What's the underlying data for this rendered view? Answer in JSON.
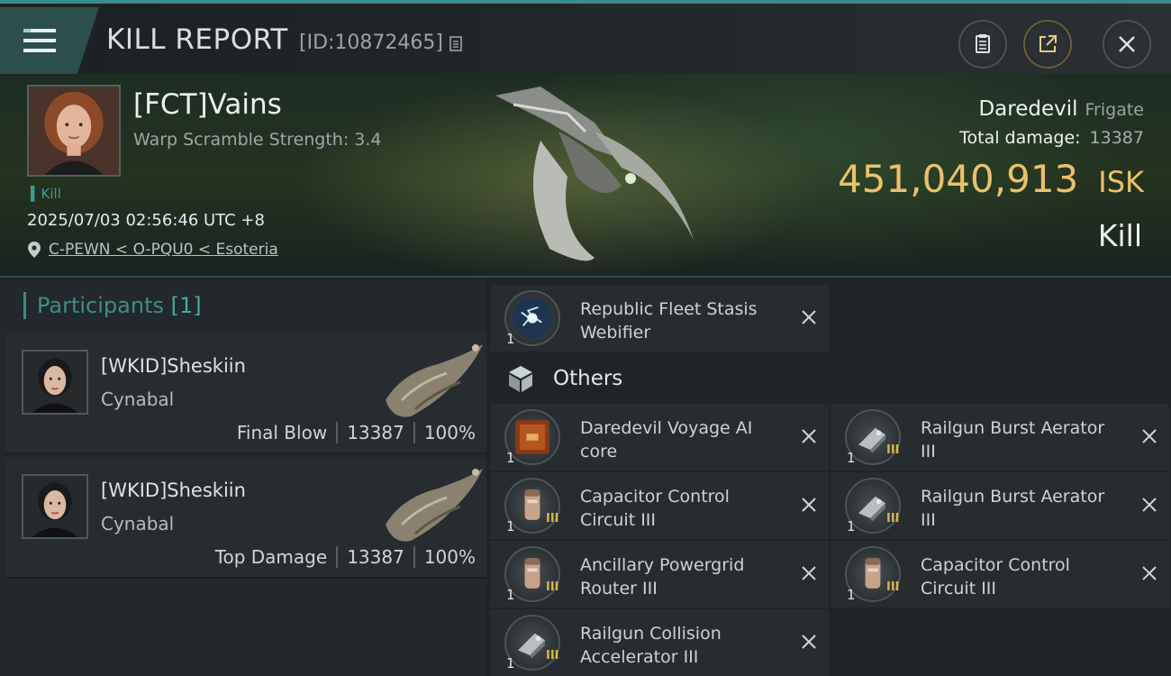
{
  "header": {
    "title": "KILL REPORT",
    "report_id": "[ID:10872465]"
  },
  "victim": {
    "name": "[FCT]Vains",
    "warp_scramble": "Warp Scramble Strength: 3.4",
    "kill_tag": "Kill",
    "timestamp": "2025/07/03 02:56:46 UTC +8",
    "location": "C-PEWN < O-PQU0 < Esoteria",
    "ship_name": "Daredevil",
    "ship_class": "Frigate",
    "total_damage_label": "Total damage:",
    "total_damage": "13387",
    "isk_value": "451,040,913",
    "isk_unit": "ISK",
    "result": "Kill"
  },
  "participants": {
    "label": "Participants",
    "count": "[1]",
    "rows": [
      {
        "name": "[WKID]Sheskiin",
        "ship": "Cynabal",
        "role": "Final Blow",
        "damage": "13387",
        "percent": "100%"
      },
      {
        "name": "[WKID]Sheskiin",
        "ship": "Cynabal",
        "role": "Top Damage",
        "damage": "13387",
        "percent": "100%"
      }
    ]
  },
  "items": {
    "top_item": {
      "qty": "1",
      "name": "Republic Fleet Stasis Webifier"
    },
    "others_label": "Others",
    "others": [
      {
        "qty": "1",
        "name": "Daredevil Voyage AI core",
        "meta": ""
      },
      {
        "qty": "1",
        "name": "Railgun Burst Aerator III",
        "meta": "III"
      },
      {
        "qty": "1",
        "name": "Capacitor Control Circuit III",
        "meta": "III"
      },
      {
        "qty": "1",
        "name": "Railgun Burst Aerator III",
        "meta": "III"
      },
      {
        "qty": "1",
        "name": "Ancillary Powergrid Router III",
        "meta": "III"
      },
      {
        "qty": "1",
        "name": "Capacitor Control Circuit III",
        "meta": "III"
      },
      {
        "qty": "1",
        "name": "Railgun Collision Accelerator III",
        "meta": "III"
      }
    ]
  },
  "colors": {
    "accent": "#3e8d89",
    "isk": "#e9c26a"
  }
}
